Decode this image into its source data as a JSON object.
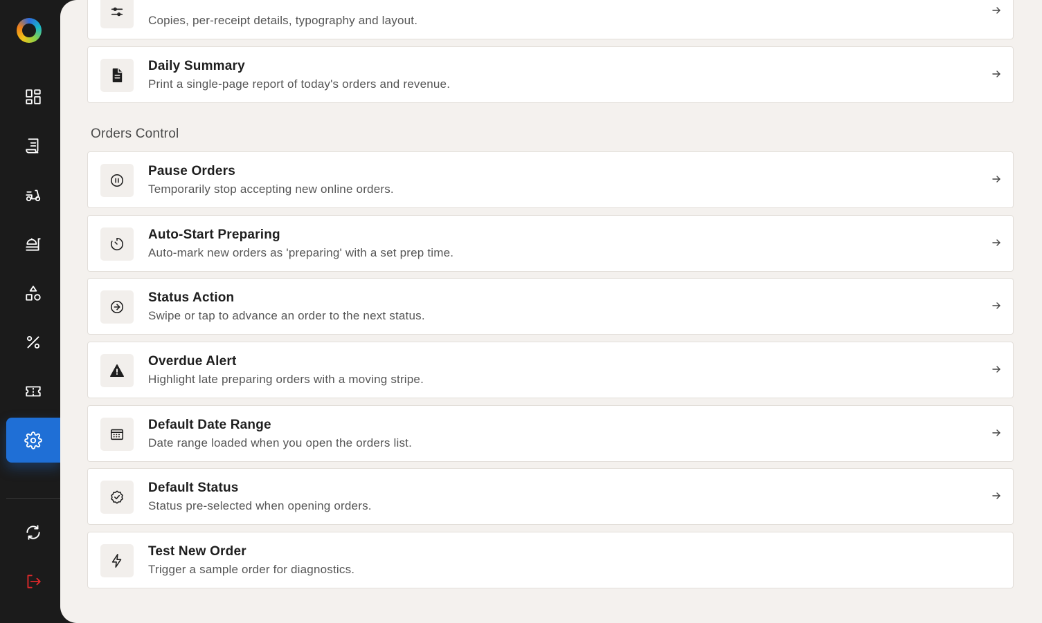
{
  "sidebar": {
    "items": [
      {
        "name": "dashboard",
        "icon": "dashboard-icon"
      },
      {
        "name": "orders",
        "icon": "receipt-icon"
      },
      {
        "name": "delivery",
        "icon": "scooter-icon"
      },
      {
        "name": "menu",
        "icon": "food-tray-icon"
      },
      {
        "name": "categories",
        "icon": "shapes-icon"
      },
      {
        "name": "discounts",
        "icon": "percent-icon"
      },
      {
        "name": "coupons",
        "icon": "ticket-icon"
      },
      {
        "name": "settings",
        "icon": "gear-icon",
        "active": true
      }
    ],
    "bottom": [
      {
        "name": "sync",
        "icon": "sync-icon"
      },
      {
        "name": "logout",
        "icon": "logout-icon"
      }
    ],
    "accent_color": "#1f6fd6",
    "logout_color": "#e0292b"
  },
  "printing": {
    "cards": [
      {
        "title": "",
        "description": "Copies, per-receipt details, typography and layout.",
        "icon": "sliders-icon"
      },
      {
        "title": "Daily Summary",
        "description": "Print a single-page report of today's orders and revenue.",
        "icon": "document-icon"
      }
    ]
  },
  "orders_control": {
    "section_title": "Orders Control",
    "cards": [
      {
        "title": "Pause Orders",
        "description": "Temporarily stop accepting new online orders.",
        "icon": "pause-circle-icon"
      },
      {
        "title": "Auto-Start Preparing",
        "description": "Auto-mark new orders as 'preparing' with a set prep time.",
        "icon": "timer-icon"
      },
      {
        "title": "Status Action",
        "description": "Swipe or tap to advance an order to the next status.",
        "icon": "arrow-circle-icon"
      },
      {
        "title": "Overdue Alert",
        "description": "Highlight late preparing orders with a moving stripe.",
        "icon": "warning-icon"
      },
      {
        "title": "Default Date Range",
        "description": "Date range loaded when you open the orders list.",
        "icon": "calendar-icon"
      },
      {
        "title": "Default Status",
        "description": "Status pre-selected when opening orders.",
        "icon": "badge-check-icon"
      },
      {
        "title": "Test New Order",
        "description": "Trigger a sample order for diagnostics.",
        "icon": "lightning-icon"
      }
    ]
  }
}
